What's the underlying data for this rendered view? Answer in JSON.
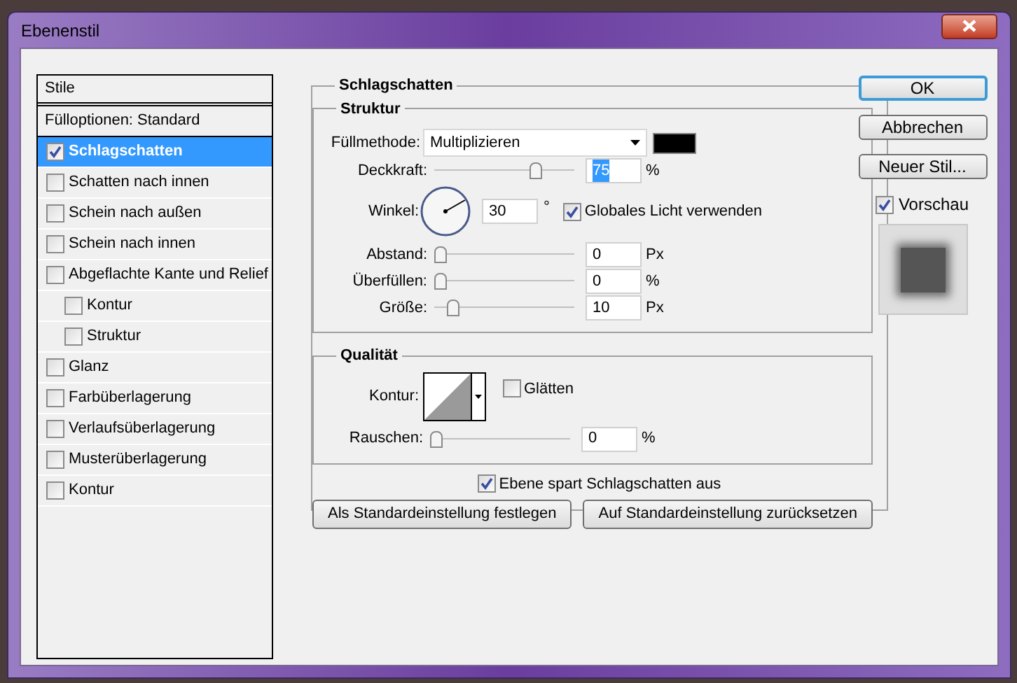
{
  "window": {
    "title": "Ebenenstil"
  },
  "styles_panel": {
    "header": "Stile",
    "blend_options": "Fülloptionen: Standard",
    "items": [
      {
        "label": "Schlagschatten",
        "checked": true,
        "selected": true
      },
      {
        "label": "Schatten nach innen",
        "checked": false,
        "selected": false
      },
      {
        "label": "Schein nach außen",
        "checked": false,
        "selected": false
      },
      {
        "label": "Schein nach innen",
        "checked": false,
        "selected": false
      },
      {
        "label": "Abgeflachte Kante und Relief",
        "checked": false,
        "selected": false,
        "children": [
          {
            "label": "Kontur",
            "checked": false,
            "selected": false
          },
          {
            "label": "Struktur",
            "checked": false,
            "selected": false
          }
        ]
      },
      {
        "label": "Glanz",
        "checked": false,
        "selected": false
      },
      {
        "label": "Farbüberlagerung",
        "checked": false,
        "selected": false
      },
      {
        "label": "Verlaufsüberlagerung",
        "checked": false,
        "selected": false
      },
      {
        "label": "Musterüberlagerung",
        "checked": false,
        "selected": false
      },
      {
        "label": "Kontur",
        "checked": false,
        "selected": false
      }
    ]
  },
  "settings": {
    "title": "Schlagschatten",
    "structure": {
      "title": "Struktur",
      "blend_mode": {
        "label": "Füllmethode:",
        "value": "Multiplizieren",
        "color": "#000000"
      },
      "opacity": {
        "label": "Deckkraft:",
        "level": 0.75,
        "value": "75",
        "unit": "%",
        "selected": true
      },
      "angle": {
        "label": "Winkel:",
        "value": "30",
        "unit": "°",
        "global_light": {
          "label": "Globales Licht verwenden",
          "checked": true
        }
      },
      "sliders": [
        {
          "label": "Abstand:",
          "level": 0,
          "value": "0",
          "unit": "Px"
        },
        {
          "label": "Überfüllen:",
          "level": 0,
          "value": "0",
          "unit": "%"
        },
        {
          "label": "Größe:",
          "level": 0.1,
          "value": "10",
          "unit": "Px"
        }
      ]
    },
    "quality": {
      "title": "Qualität",
      "contour_label": "Kontur:",
      "antialias": {
        "label": "Glätten",
        "checked": false
      },
      "noise": {
        "label": "Rauschen:",
        "level": 0,
        "value": "0",
        "unit": "%"
      }
    },
    "knockout": {
      "label": "Ebene spart Schlagschatten aus",
      "checked": true
    },
    "buttons": [
      "Als Standardeinstellung festlegen",
      "Auf Standardeinstellung zurücksetzen"
    ]
  },
  "actions": [
    {
      "label": "OK",
      "default": true
    },
    {
      "label": "Abbrechen",
      "default": false
    },
    {
      "label": "Neuer Stil...",
      "default": false
    }
  ],
  "preview": {
    "label": "Vorschau",
    "checked": true
  }
}
